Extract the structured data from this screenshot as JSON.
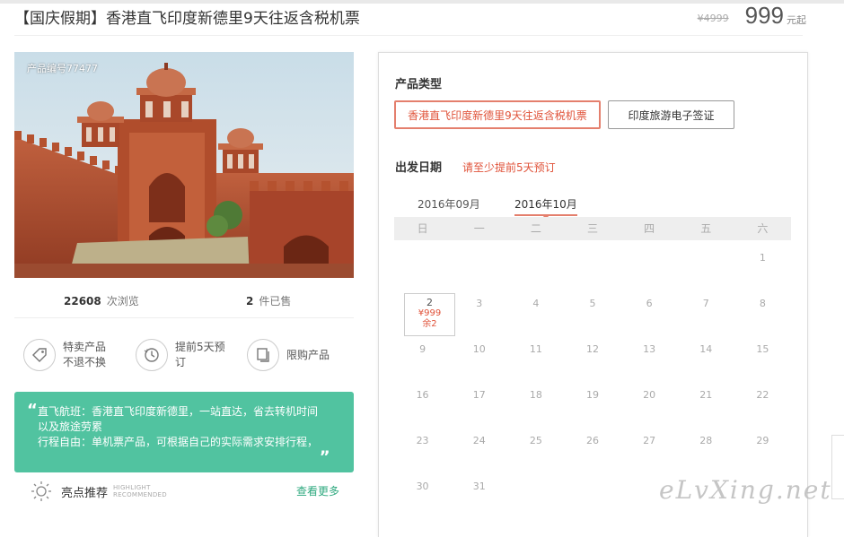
{
  "product": {
    "title": "【国庆假期】香港直飞印度新德里9天往返含税机票",
    "old_price": "¥4999",
    "price": "999",
    "price_unit": "元起",
    "photo_code": "产品编号77477"
  },
  "stats": {
    "views_count": "22608",
    "views_label": "次浏览",
    "sold_count": "2",
    "sold_label": "件已售"
  },
  "features": [
    {
      "icon": "tag-icon",
      "label": "特卖产品\n不退不换"
    },
    {
      "icon": "clock-icon",
      "label": "提前5天预\n订"
    },
    {
      "icon": "copy-icon",
      "label": "限购产品"
    }
  ],
  "notice": {
    "line1": "直飞航班：香港直飞印度新德里，一站直达，省去转机时间",
    "line2": "以及旅途劳累",
    "line3": "行程自由：单机票产品，可根据自己的实际需求安排行程，",
    "open_quote": "“",
    "close_quote": "„"
  },
  "highlight": {
    "label": "亮点推荐",
    "sub1": "HIGHLIGHT",
    "sub2": "RECOMMENDED",
    "more": "查看更多"
  },
  "booking": {
    "type_title": "产品类型",
    "option_selected": "香港直飞印度新德里9天往返含税机票",
    "option_other": "印度旅游电子签证",
    "date_title": "出发日期",
    "date_hint": "请至少提前5天预订",
    "month_prev": "2016年09月",
    "month_active": "2016年10月",
    "weekdays": [
      "日",
      "一",
      "二",
      "三",
      "四",
      "五",
      "六"
    ]
  },
  "calendar": {
    "days": [
      "",
      "",
      "",
      "",
      "",
      "",
      "1",
      "2",
      "3",
      "4",
      "5",
      "6",
      "7",
      "8",
      "9",
      "10",
      "11",
      "12",
      "13",
      "14",
      "15",
      "16",
      "17",
      "18",
      "19",
      "20",
      "21",
      "22",
      "23",
      "24",
      "25",
      "26",
      "27",
      "28",
      "29",
      "30",
      "31"
    ],
    "available_day": "2",
    "available_price": "¥999",
    "available_stock": "余2"
  },
  "watermark": "eLvXing.net",
  "colors": {
    "accent": "#e0533a",
    "green": "#51c3a0",
    "link_green": "#2fa97f"
  }
}
